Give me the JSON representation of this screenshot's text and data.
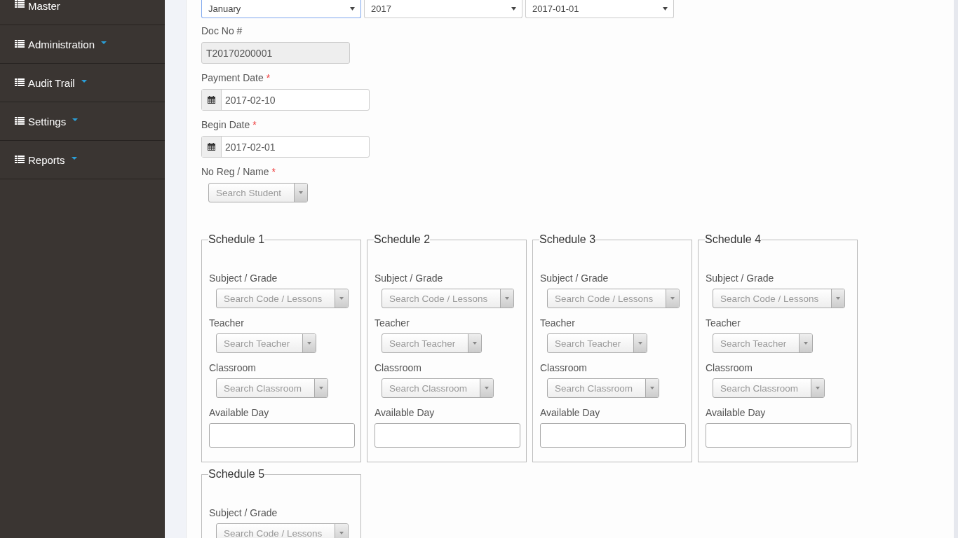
{
  "sidebar": {
    "items": [
      {
        "label": "Master"
      },
      {
        "label": "Administration"
      },
      {
        "label": "Audit Trail"
      },
      {
        "label": "Settings"
      },
      {
        "label": "Reports"
      }
    ]
  },
  "period_selects": [
    {
      "value": "January",
      "focused": true
    },
    {
      "value": "2017",
      "focused": false
    },
    {
      "value": "2017-01-01",
      "focused": false
    }
  ],
  "doc_no": {
    "label": "Doc No #",
    "value": "T20170200001"
  },
  "dates": [
    {
      "label": "Payment Date",
      "required_mark": "*",
      "value": "2017-02-10"
    },
    {
      "label": "Begin Date",
      "required_mark": "*",
      "value": "2017-02-01"
    }
  ],
  "student": {
    "label": "No Reg / Name",
    "required_mark": "*",
    "placeholder": "Search Student"
  },
  "schedules": [
    {
      "title": "Schedule 1",
      "fields": [
        {
          "label": "Subject / Grade",
          "kind": "select",
          "placeholder": "Search Code / Lessons"
        },
        {
          "label": "Teacher",
          "kind": "select",
          "placeholder": "Search Teacher"
        },
        {
          "label": "Classroom",
          "kind": "select",
          "placeholder": "Search Classroom"
        },
        {
          "label": "Available Day",
          "kind": "text"
        }
      ]
    },
    {
      "title": "Schedule 2",
      "fields": [
        {
          "label": "Subject / Grade",
          "kind": "select",
          "placeholder": "Search Code / Lessons"
        },
        {
          "label": "Teacher",
          "kind": "select",
          "placeholder": "Search Teacher"
        },
        {
          "label": "Classroom",
          "kind": "select",
          "placeholder": "Search Classroom"
        },
        {
          "label": "Available Day",
          "kind": "text"
        }
      ]
    },
    {
      "title": "Schedule 3",
      "fields": [
        {
          "label": "Subject / Grade",
          "kind": "select",
          "placeholder": "Search Code / Lessons"
        },
        {
          "label": "Teacher",
          "kind": "select",
          "placeholder": "Search Teacher"
        },
        {
          "label": "Classroom",
          "kind": "select",
          "placeholder": "Search Classroom"
        },
        {
          "label": "Available Day",
          "kind": "text"
        }
      ]
    },
    {
      "title": "Schedule 4",
      "fields": [
        {
          "label": "Subject / Grade",
          "kind": "select",
          "placeholder": "Search Code / Lessons"
        },
        {
          "label": "Teacher",
          "kind": "select",
          "placeholder": "Search Teacher"
        },
        {
          "label": "Classroom",
          "kind": "select",
          "placeholder": "Search Classroom"
        },
        {
          "label": "Available Day",
          "kind": "text"
        }
      ]
    },
    {
      "title": "Schedule 5",
      "fields": [
        {
          "label": "Subject / Grade",
          "kind": "select",
          "placeholder": "Search Code / Lessons"
        }
      ]
    }
  ]
}
